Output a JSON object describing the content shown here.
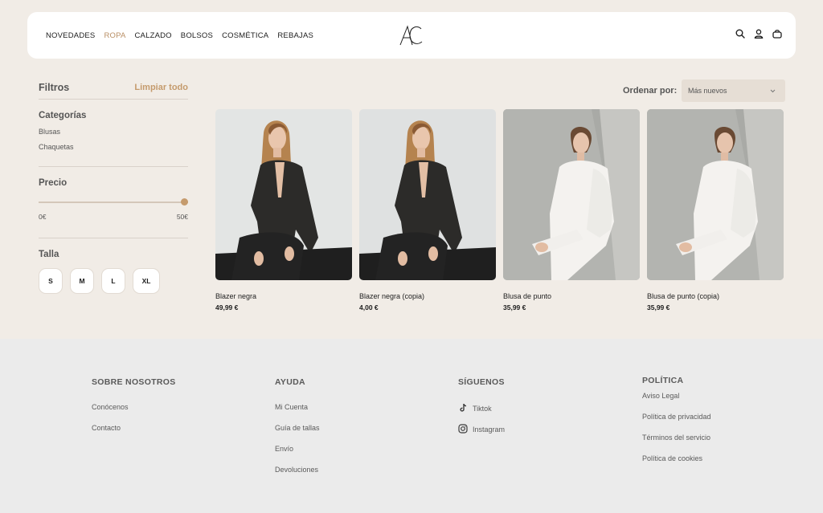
{
  "header": {
    "nav": [
      "NOVEDADES",
      "ROPA",
      "CALZADO",
      "BOLSOS",
      "COSMÉTICA",
      "REBAJAS"
    ],
    "active_nav": "ROPA",
    "logo_text": "AC",
    "icons": [
      "search-icon",
      "user-icon",
      "cart-icon"
    ]
  },
  "filters": {
    "title": "Filtros",
    "clear_all": "Limpiar todo",
    "categories": {
      "heading": "Categorías",
      "items": [
        "Blusas",
        "Chaquetas"
      ]
    },
    "price": {
      "heading": "Precio",
      "min_label": "0€",
      "max_label": "50€",
      "slider_value_fraction": 1.0
    },
    "size": {
      "heading": "Talla",
      "options": [
        "S",
        "M",
        "L",
        "XL"
      ]
    }
  },
  "sort": {
    "label": "Ordenar por:",
    "selected": "Más nuevos"
  },
  "products": [
    {
      "name": "Blazer negra",
      "price": "49,99 €",
      "image": "woman-black-blazer-photo"
    },
    {
      "name": "Blazer negra (copia)",
      "price": "4,00 €",
      "image": "woman-black-blazer-photo"
    },
    {
      "name": "Blusa de punto",
      "price": "35,99 €",
      "image": "woman-white-knit-blouse-photo"
    },
    {
      "name": "Blusa de punto (copia)",
      "price": "35,99 €",
      "image": "woman-white-knit-blouse-photo"
    }
  ],
  "footer": {
    "about": {
      "heading": "SOBRE NOSOTROS",
      "links": [
        "Conócenos",
        "Contacto"
      ]
    },
    "help": {
      "heading": "AYUDA",
      "links": [
        "Mi Cuenta",
        "Guía de tallas",
        "Envío",
        "Devoluciones"
      ]
    },
    "social": {
      "heading": "SÍGUENOS",
      "links": [
        "Tiktok",
        "Instagram"
      ]
    },
    "policy": {
      "heading": "POLÍTICA",
      "links": [
        "Aviso Legal",
        "Política de privacidad",
        "Términos del servicio",
        "Política de cookies"
      ]
    }
  },
  "colors": {
    "accent": "#c59b6d",
    "background": "#f1ece6",
    "footer_bg": "#ebebeb"
  }
}
